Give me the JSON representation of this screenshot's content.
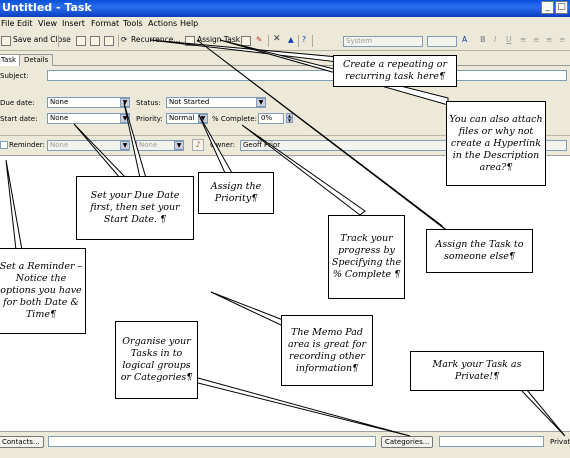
{
  "window": {
    "title": "Untitled - Task",
    "min": "_",
    "max": "□",
    "close": "×"
  },
  "menu": [
    "File",
    "Edit",
    "View",
    "Insert",
    "Format",
    "Tools",
    "Actions",
    "Help"
  ],
  "toolbar": {
    "save_close": "Save and Close",
    "recurrence": "Recurrence...",
    "assign_task": "Assign Task",
    "font": "System"
  },
  "tabs": [
    "Task",
    "Details"
  ],
  "form": {
    "subject_label": "Subject:",
    "due_label": "Due date:",
    "due_value": "None",
    "start_label": "Start date:",
    "start_value": "None",
    "status_label": "Status:",
    "status_value": "Not Started",
    "priority_label": "Priority:",
    "priority_value": "Normal",
    "complete_label": "% Complete:",
    "complete_value": "0%",
    "reminder_label": "Reminder:",
    "reminder_date": "None",
    "reminder_time": "None",
    "owner_label": "Owner:",
    "owner_value": "Geoff Prior"
  },
  "bottom": {
    "contacts": "Contacts...",
    "categories": "Categories...",
    "private": "Private"
  },
  "callouts": {
    "recurring": "Create a repeating or recurring task here¶",
    "attach": "You can also attach files or why not create a Hyperlink in the Description area?¶",
    "duedate": "Set your Due Date first, then set your Start Date. ¶",
    "priority": "Assign the Priority¶",
    "progress": "Track your progress by Specifying the % Complete ¶",
    "assign": "Assign the Task to someone else¶",
    "reminder": "Set a Reminder – Notice the options you have for both Date & Time¶",
    "memo": "The Memo Pad area is great for recording other information¶",
    "categories": "Organise your Tasks in to logical groups or Categories¶",
    "private": "Mark your Task as Private!¶"
  }
}
